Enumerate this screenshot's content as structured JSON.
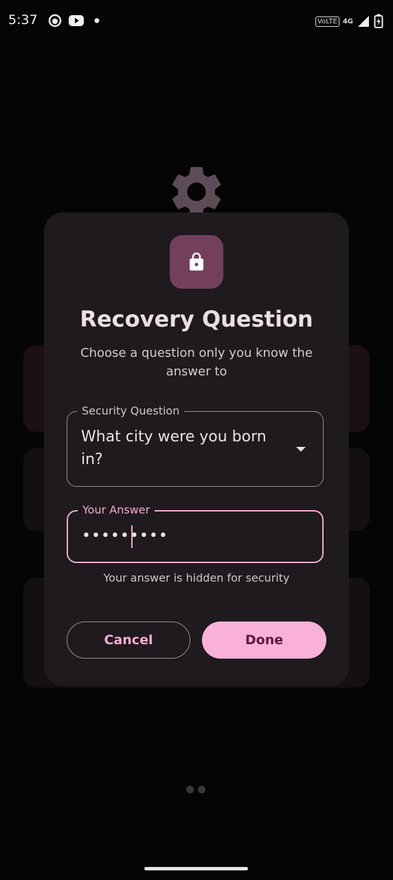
{
  "status_bar": {
    "time": "5:37",
    "icons": [
      "notification-app-icon",
      "youtube-icon",
      "dot-icon"
    ],
    "volte": "VoLTE",
    "network": "4G",
    "right_icons": [
      "signal-icon",
      "battery-charging-icon"
    ]
  },
  "dialog": {
    "icon": "lock-icon",
    "title": "Recovery Question",
    "subtitle": "Choose a question only you know the answer to",
    "question_field": {
      "label": "Security Question",
      "value": "What city were you born in?"
    },
    "answer_field": {
      "label": "Your Answer",
      "value": "•••••••••"
    },
    "helper_text": "Your answer is hidden for security",
    "cancel_label": "Cancel",
    "done_label": "Done"
  },
  "pager": {
    "count": 2
  },
  "colors": {
    "accent": "#f6abd3",
    "dialog_bg": "#1f1a1d",
    "icon_tile": "#72405d",
    "done_button": "#f9b1d8"
  }
}
